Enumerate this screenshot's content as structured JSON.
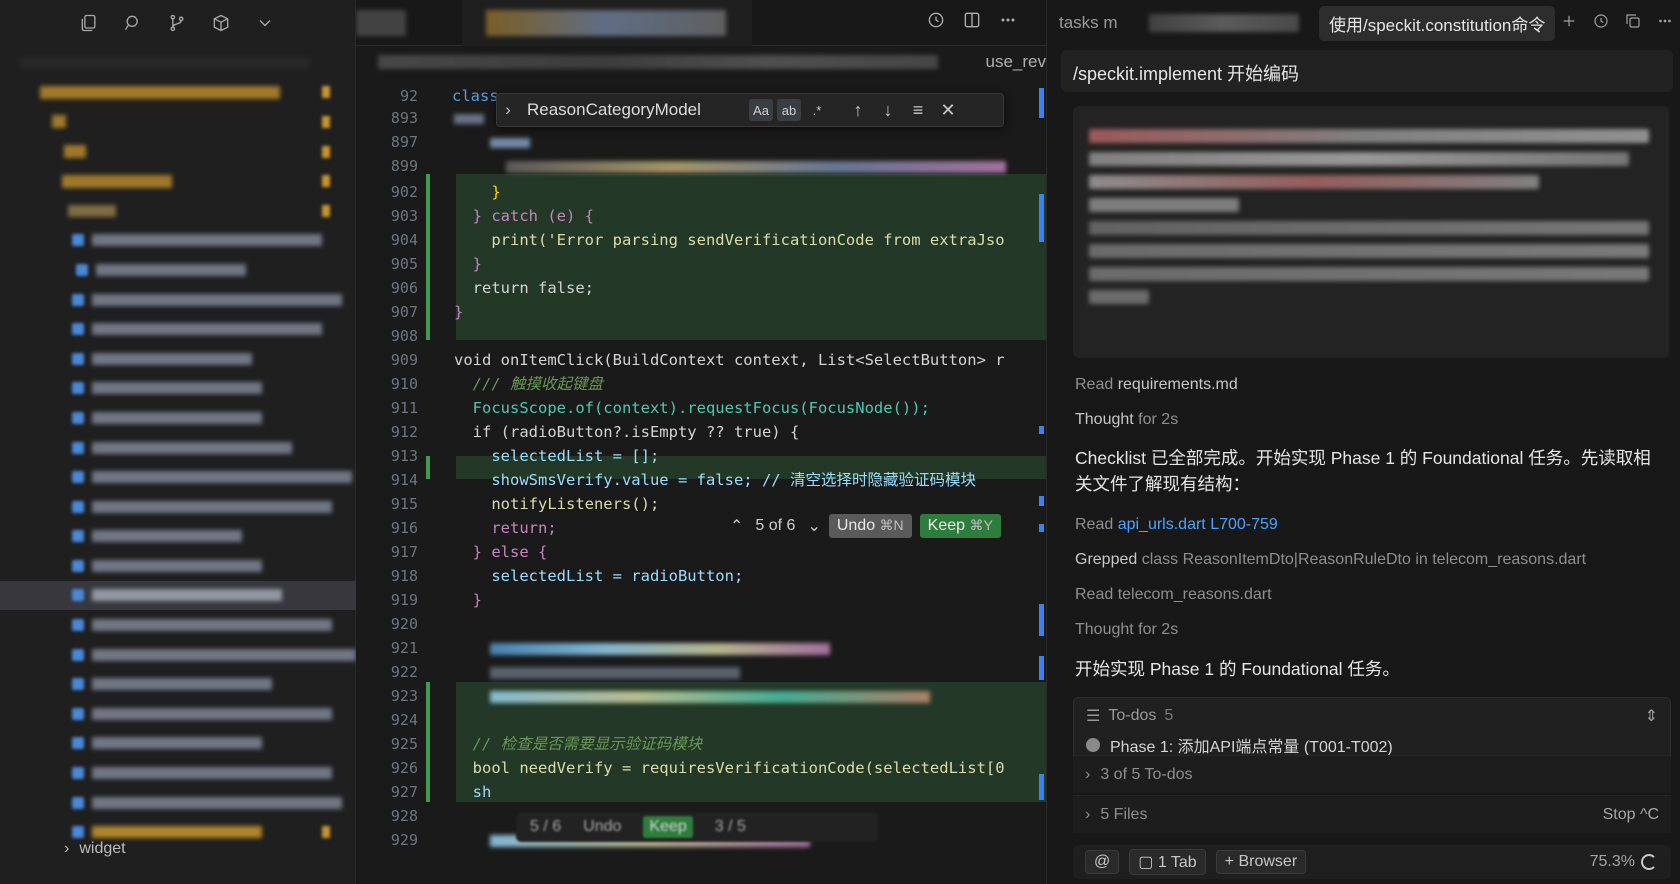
{
  "sidebar": {
    "toolbar": [
      {
        "name": "explorer-icon"
      },
      {
        "name": "search-icon"
      },
      {
        "name": "source-control-icon"
      },
      {
        "name": "extensions-icon"
      },
      {
        "name": "chevron-down-icon"
      }
    ],
    "bottom_item": "widget"
  },
  "editor": {
    "breadcrumb_tail": "use_rev",
    "find": {
      "value": "ReasonCategoryModel",
      "match_case": "Aa",
      "whole_word": "ab",
      "regex": ".*"
    },
    "hunk": {
      "counter": "5 of 6",
      "undo": "Undo",
      "undo_key": "⌘N",
      "keep": "Keep",
      "keep_key": "⌘Y"
    },
    "bottom": {
      "counter": "5 / 6",
      "undo": "Undo",
      "keep": "Keep",
      "files": "3 / 5"
    },
    "lines": [
      {
        "n": "92",
        "t": "class"
      },
      {
        "n": "893",
        "t": ""
      },
      {
        "n": "897",
        "t": ""
      },
      {
        "n": "899",
        "t": ""
      },
      {
        "n": "902",
        "t": "    }"
      },
      {
        "n": "903",
        "t": "  } catch (e) {"
      },
      {
        "n": "904",
        "t": "    print('Error parsing sendVerificationCode from extraJso"
      },
      {
        "n": "905",
        "t": "  }"
      },
      {
        "n": "906",
        "t": "  return false;"
      },
      {
        "n": "907",
        "t": "}"
      },
      {
        "n": "908",
        "t": ""
      },
      {
        "n": "909",
        "t": "void onItemClick(BuildContext context, List<SelectButton> r"
      },
      {
        "n": "910",
        "t": "  /// 触摸收起键盘"
      },
      {
        "n": "911",
        "t": "  FocusScope.of(context).requestFocus(FocusNode());"
      },
      {
        "n": "912",
        "t": "  if (radioButton?.isEmpty ?? true) {"
      },
      {
        "n": "913",
        "t": "    selectedList = [];"
      },
      {
        "n": "914",
        "t": "    showSmsVerify.value = false; // 清空选择时隐藏验证码模块"
      },
      {
        "n": "915",
        "t": "    notifyListeners();"
      },
      {
        "n": "916",
        "t": "    return;"
      },
      {
        "n": "917",
        "t": "  } else {"
      },
      {
        "n": "918",
        "t": "    selectedList = radioButton;"
      },
      {
        "n": "919",
        "t": "  }"
      },
      {
        "n": "920",
        "t": ""
      },
      {
        "n": "921",
        "t": ""
      },
      {
        "n": "922",
        "t": ""
      },
      {
        "n": "923",
        "t": ""
      },
      {
        "n": "924",
        "t": ""
      },
      {
        "n": "925",
        "t": "  // 检查是否需要显示验证码模块"
      },
      {
        "n": "926",
        "t": "  bool needVerify = requiresVerificationCode(selectedList[0"
      },
      {
        "n": "927",
        "t": "  sh"
      },
      {
        "n": "928",
        "t": ""
      },
      {
        "n": "929",
        "t": ""
      }
    ]
  },
  "chat": {
    "tab_tasks": "tasks m",
    "tab_active": "使用/speckit.constitution命令",
    "prompt": "/speckit.implement 开始编码",
    "activities": {
      "read1_verb": "Read",
      "read1_file": "requirements.md",
      "thought1_verb": "Thought",
      "thought1_time": "for 2s",
      "checklist_msg": "Checklist 已全部完成。开始实现 Phase 1 的 Foundational 任务。先读取相关文件了解现有结构：",
      "read2_verb": "Read",
      "read2_file": "api_urls.dart L700-759",
      "grep_verb": "Grepped",
      "grep_detail": "class ReasonItemDto|ReasonRuleDto in telecom_reasons.dart",
      "read3_verb": "Read",
      "read3_file": "telecom_reasons.dart",
      "thought2_verb": "Thought",
      "thought2_time": "for 2s",
      "start_msg": "开始实现 Phase 1 的 Foundational 任务。"
    },
    "todos": {
      "label": "To-dos",
      "count": "5",
      "item": "Phase 1: 添加API端点常量 (T001-T002)"
    },
    "progress": "3 of 5 To-dos",
    "files": "5 Files",
    "stop": "Stop ^C",
    "composer": {
      "at": "@",
      "tabs": "1 Tab",
      "browser": "Browser",
      "context": "75.3%"
    }
  }
}
